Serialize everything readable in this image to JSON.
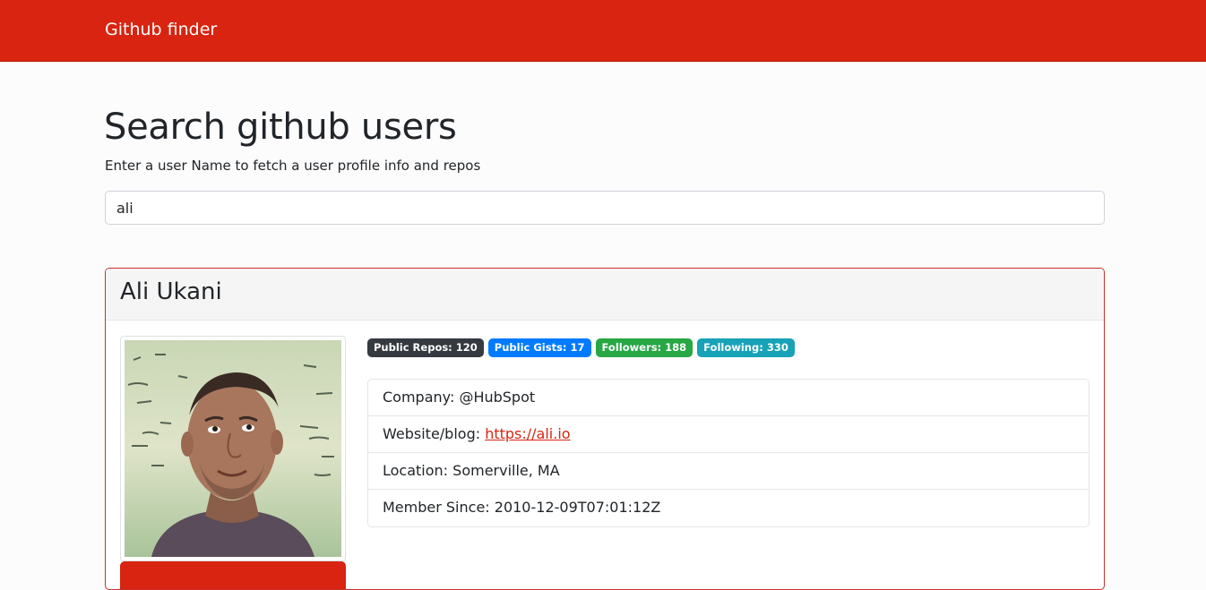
{
  "navbar": {
    "brand": "Github finder",
    "color": "#d82410"
  },
  "search": {
    "title": "Search github users",
    "subtitle": "Enter a user Name to fetch a user profile info and repos",
    "value": "ali"
  },
  "profile": {
    "name": "Ali Ukani",
    "avatar_icon": "user-avatar-photo",
    "badges": [
      {
        "label": "Public Repos: 120",
        "color": "#343a40"
      },
      {
        "label": "Public Gists: 17",
        "color": "#007bff"
      },
      {
        "label": "Followers: 188",
        "color": "#28a745"
      },
      {
        "label": "Following: 330",
        "color": "#17a2b8"
      }
    ],
    "details": {
      "company_label": "Company:",
      "company_value": "@HubSpot",
      "website_label": "Website/blog:",
      "website_value": "https://ali.io",
      "location_label": "Location:",
      "location_value": "Somerville, MA",
      "member_label": "Member Since:",
      "member_value": "2010-12-09T07:01:12Z"
    }
  }
}
